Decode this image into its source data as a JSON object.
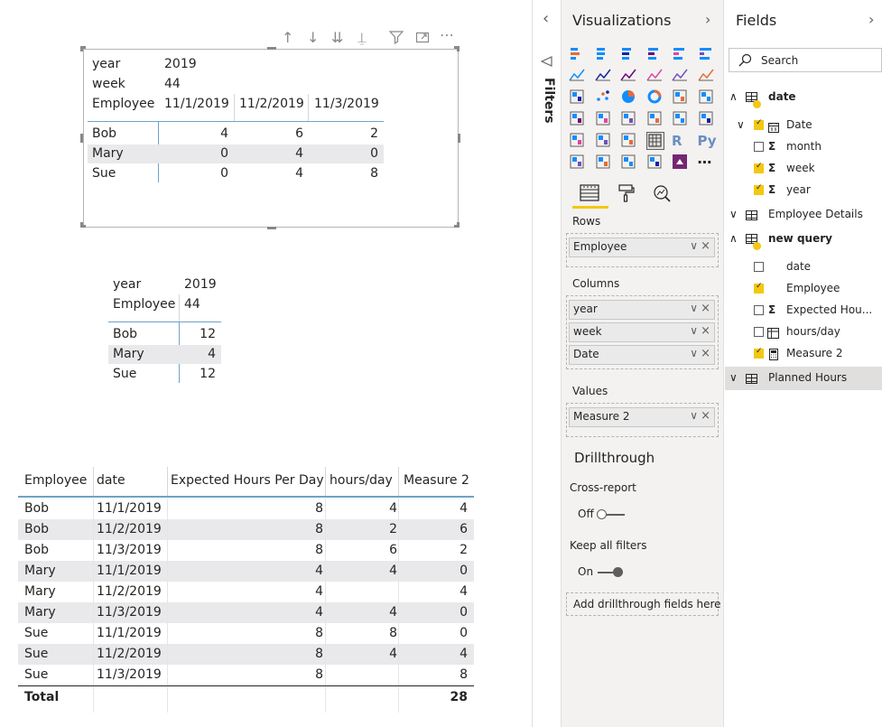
{
  "toolbar_icons": [
    "arrow-up-icon",
    "arrow-down-icon",
    "double-arrow-down-icon",
    "expand-hierarchy-icon",
    "filter-icon",
    "focus-mode-icon",
    "more-options-icon"
  ],
  "toolbar_more": "⋯",
  "matrix1": {
    "year_label": "year",
    "year_value": "2019",
    "week_label": "week",
    "week_value": "44",
    "employee_label": "Employee",
    "columns": [
      "11/1/2019",
      "11/2/2019",
      "11/3/2019"
    ],
    "rows": [
      {
        "name": "Bob",
        "values": [
          "4",
          "6",
          "2"
        ]
      },
      {
        "name": "Mary",
        "values": [
          "0",
          "4",
          "0"
        ]
      },
      {
        "name": "Sue",
        "values": [
          "0",
          "4",
          "8"
        ]
      }
    ]
  },
  "matrix2": {
    "year_label": "year",
    "year_value": "2019",
    "employee_label": "Employee",
    "week_value": "44",
    "rows": [
      {
        "name": "Bob",
        "value": "12"
      },
      {
        "name": "Mary",
        "value": "4"
      },
      {
        "name": "Sue",
        "value": "12"
      }
    ]
  },
  "table": {
    "headers": [
      "Employee",
      "date",
      "Expected Hours Per Day",
      "hours/day",
      "Measure 2"
    ],
    "rows": [
      [
        "Bob",
        "11/1/2019",
        "8",
        "4",
        "4"
      ],
      [
        "Bob",
        "11/2/2019",
        "8",
        "2",
        "6"
      ],
      [
        "Bob",
        "11/3/2019",
        "8",
        "6",
        "2"
      ],
      [
        "Mary",
        "11/1/2019",
        "4",
        "4",
        "0"
      ],
      [
        "Mary",
        "11/2/2019",
        "4",
        "",
        "4"
      ],
      [
        "Mary",
        "11/3/2019",
        "4",
        "4",
        "0"
      ],
      [
        "Sue",
        "11/1/2019",
        "8",
        "8",
        "0"
      ],
      [
        "Sue",
        "11/2/2019",
        "8",
        "4",
        "4"
      ],
      [
        "Sue",
        "11/3/2019",
        "8",
        "",
        "8"
      ]
    ],
    "total_label": "Total",
    "total_value": "28"
  },
  "filters": {
    "label": "Filters",
    "collapse_glyph": "‹"
  },
  "visualizations": {
    "title": "Visualizations",
    "expand_glyph": "›",
    "icon_names": [
      [
        "stacked-bar-icon",
        "stacked-column-icon",
        "clustered-bar-icon",
        "clustered-column-icon",
        "100-stacked-bar-icon",
        "100-stacked-column-icon"
      ],
      [
        "line-chart-icon",
        "area-chart-icon",
        "stacked-area-icon",
        "line-column-icon",
        "line-clustered-column-icon",
        "ribbon-chart-icon"
      ],
      [
        "waterfall-icon",
        "scatter-icon",
        "pie-icon",
        "donut-icon",
        "treemap-icon",
        "map-icon"
      ],
      [
        "filled-map-icon",
        "shape-map-icon",
        "funnel-icon",
        "gauge-icon",
        "card-icon",
        "multi-row-card-icon"
      ],
      [
        "kpi-icon",
        "slicer-icon",
        "table-icon",
        "matrix-icon",
        "r-visual-icon",
        "python-visual-icon"
      ],
      [
        "key-influencers-icon",
        "decomposition-tree-icon",
        "qa-icon",
        "globe-icon",
        "powerapps-icon",
        "more-visuals-icon"
      ]
    ],
    "r_label": "R",
    "py_label": "Py",
    "more_label": "⋯",
    "tabs": [
      "fields-tab-icon",
      "format-tab-icon",
      "analytics-tab-icon"
    ],
    "rows_label": "Rows",
    "rows_fields": [
      "Employee"
    ],
    "columns_label": "Columns",
    "columns_fields": [
      "year",
      "week",
      "Date"
    ],
    "values_label": "Values",
    "values_fields": [
      "Measure 2"
    ],
    "pill_chevron": "∨",
    "pill_close": "×",
    "drillthrough_title": "Drillthrough",
    "cross_report_label": "Cross-report",
    "cross_report_state": "Off",
    "keep_filters_label": "Keep all filters",
    "keep_filters_state": "On",
    "drill_placeholder": "Add drillthrough fields here",
    "colors": {
      "accent": "#f2c811",
      "toggle": "#605e5c",
      "pane_bg": "#f3f2f1"
    }
  },
  "fields": {
    "title": "Fields",
    "expand_glyph": "›",
    "search_placeholder": "Search",
    "expanded_glyph": "∧",
    "collapsed_glyph": "∨",
    "tables": [
      {
        "name": "date"
      },
      {
        "name": "Employee Details"
      },
      {
        "name": "new query"
      },
      {
        "name": "Planned Hours"
      }
    ],
    "date_items": [
      "Date",
      "month",
      "week",
      "year"
    ],
    "newquery_items": [
      "date",
      "Employee",
      "Expected Hou...",
      "hours/day",
      "Measure 2"
    ],
    "sigma": "Σ"
  }
}
